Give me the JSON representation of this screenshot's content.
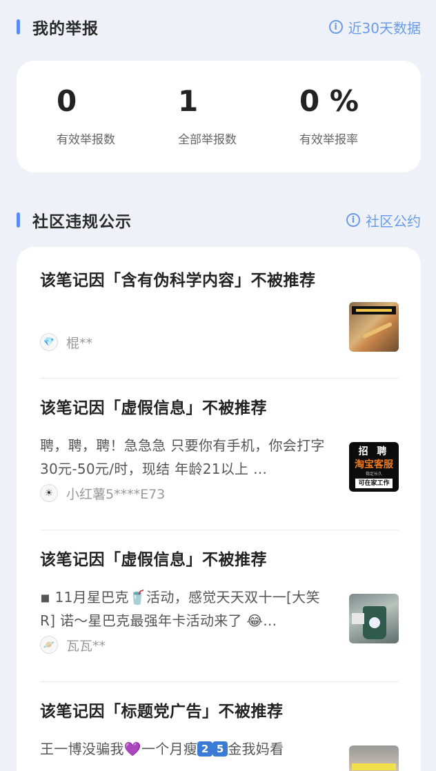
{
  "report_section": {
    "title": "我的举报",
    "link_label": "近30天数据"
  },
  "stats": [
    {
      "value": "0",
      "label": "有效举报数"
    },
    {
      "value": "1",
      "label": "全部举报数"
    },
    {
      "value": "0 %",
      "label": "有效举报率"
    }
  ],
  "violation_section": {
    "title": "社区违规公示",
    "link_label": "社区公约"
  },
  "items": [
    {
      "title": "该笔记因「含有伪科学内容」不被推荐",
      "desc": "",
      "author": "棍**",
      "author_icon": "diamond-icon"
    },
    {
      "title": "该笔记因「虚假信息」不被推荐",
      "desc": "聘，聘，聘！急急急 只要你有手机，你会打字 30元-50元/时，现结 年龄21以上 …",
      "author": "小红薯5****E73",
      "author_icon": "sun-icon",
      "thumb_text": {
        "top": "招 聘",
        "mid": "淘宝客服",
        "sub": "稳定长久",
        "bot": "可在家工作"
      }
    },
    {
      "title": "该笔记因「虚假信息」不被推荐",
      "desc": "◾ 11月星巴克🥤活动，感觉天天双十一[大笑R] 诺～星巴克最强年卡活动来了 😂…",
      "author": "瓦瓦**",
      "author_icon": "planet-icon"
    },
    {
      "title": "该笔记因「标题党广告」不被推荐",
      "desc_parts": [
        "王一博没骗我💜一个月瘦",
        "2",
        "5",
        "金我妈看"
      ],
      "author": "",
      "author_icon": ""
    }
  ],
  "colors": {
    "accent": "#5b8def",
    "link": "#6a9be8",
    "background": "#eef2f8"
  }
}
